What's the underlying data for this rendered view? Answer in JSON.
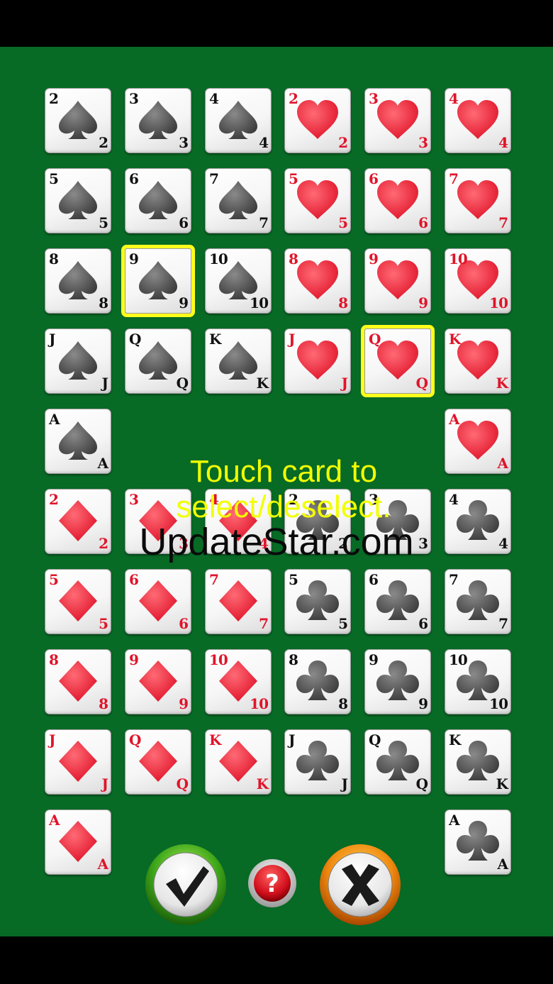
{
  "instruction_lines": [
    "Touch card to",
    "select/deselect."
  ],
  "watermark": "UpdateStar.com",
  "colors": {
    "felt": "#076a25",
    "red_suit": "#e0142a",
    "black_suit": "#3a3a3a",
    "selection": "#ffff1c",
    "instruction_text": "#f2ff00"
  },
  "cards": [
    {
      "rank": "2",
      "suit": "spades",
      "selected": false
    },
    {
      "rank": "3",
      "suit": "spades",
      "selected": false
    },
    {
      "rank": "4",
      "suit": "spades",
      "selected": false
    },
    {
      "rank": "2",
      "suit": "hearts",
      "selected": false
    },
    {
      "rank": "3",
      "suit": "hearts",
      "selected": false
    },
    {
      "rank": "4",
      "suit": "hearts",
      "selected": false
    },
    {
      "rank": "5",
      "suit": "spades",
      "selected": false
    },
    {
      "rank": "6",
      "suit": "spades",
      "selected": false
    },
    {
      "rank": "7",
      "suit": "spades",
      "selected": false
    },
    {
      "rank": "5",
      "suit": "hearts",
      "selected": false
    },
    {
      "rank": "6",
      "suit": "hearts",
      "selected": false
    },
    {
      "rank": "7",
      "suit": "hearts",
      "selected": false
    },
    {
      "rank": "8",
      "suit": "spades",
      "selected": false
    },
    {
      "rank": "9",
      "suit": "spades",
      "selected": true
    },
    {
      "rank": "10",
      "suit": "spades",
      "selected": false
    },
    {
      "rank": "8",
      "suit": "hearts",
      "selected": false
    },
    {
      "rank": "9",
      "suit": "hearts",
      "selected": false
    },
    {
      "rank": "10",
      "suit": "hearts",
      "selected": false
    },
    {
      "rank": "J",
      "suit": "spades",
      "selected": false
    },
    {
      "rank": "Q",
      "suit": "spades",
      "selected": false
    },
    {
      "rank": "K",
      "suit": "spades",
      "selected": false
    },
    {
      "rank": "J",
      "suit": "hearts",
      "selected": false
    },
    {
      "rank": "Q",
      "suit": "hearts",
      "selected": true
    },
    {
      "rank": "K",
      "suit": "hearts",
      "selected": false
    },
    {
      "rank": "A",
      "suit": "spades",
      "selected": false
    },
    {
      "rank": "A",
      "suit": "hearts",
      "selected": false
    },
    {
      "rank": "2",
      "suit": "diamonds",
      "selected": false
    },
    {
      "rank": "3",
      "suit": "diamonds",
      "selected": false
    },
    {
      "rank": "4",
      "suit": "diamonds",
      "selected": false
    },
    {
      "rank": "2",
      "suit": "clubs",
      "selected": false
    },
    {
      "rank": "3",
      "suit": "clubs",
      "selected": false
    },
    {
      "rank": "4",
      "suit": "clubs",
      "selected": false
    },
    {
      "rank": "5",
      "suit": "diamonds",
      "selected": false
    },
    {
      "rank": "6",
      "suit": "diamonds",
      "selected": false
    },
    {
      "rank": "7",
      "suit": "diamonds",
      "selected": false
    },
    {
      "rank": "5",
      "suit": "clubs",
      "selected": false
    },
    {
      "rank": "6",
      "suit": "clubs",
      "selected": false
    },
    {
      "rank": "7",
      "suit": "clubs",
      "selected": false
    },
    {
      "rank": "8",
      "suit": "diamonds",
      "selected": false
    },
    {
      "rank": "9",
      "suit": "diamonds",
      "selected": false
    },
    {
      "rank": "10",
      "suit": "diamonds",
      "selected": false
    },
    {
      "rank": "8",
      "suit": "clubs",
      "selected": false
    },
    {
      "rank": "9",
      "suit": "clubs",
      "selected": false
    },
    {
      "rank": "10",
      "suit": "clubs",
      "selected": false
    },
    {
      "rank": "J",
      "suit": "diamonds",
      "selected": false
    },
    {
      "rank": "Q",
      "suit": "diamonds",
      "selected": false
    },
    {
      "rank": "K",
      "suit": "diamonds",
      "selected": false
    },
    {
      "rank": "J",
      "suit": "clubs",
      "selected": false
    },
    {
      "rank": "Q",
      "suit": "clubs",
      "selected": false
    },
    {
      "rank": "K",
      "suit": "clubs",
      "selected": false
    },
    {
      "rank": "A",
      "suit": "diamonds",
      "selected": false
    },
    {
      "rank": "A",
      "suit": "clubs",
      "selected": false
    }
  ],
  "buttons": {
    "confirm": {
      "icon": "checkmark-icon"
    },
    "help": {
      "icon": "question-mark-icon",
      "glyph": "?"
    },
    "cancel": {
      "icon": "x-icon"
    }
  }
}
